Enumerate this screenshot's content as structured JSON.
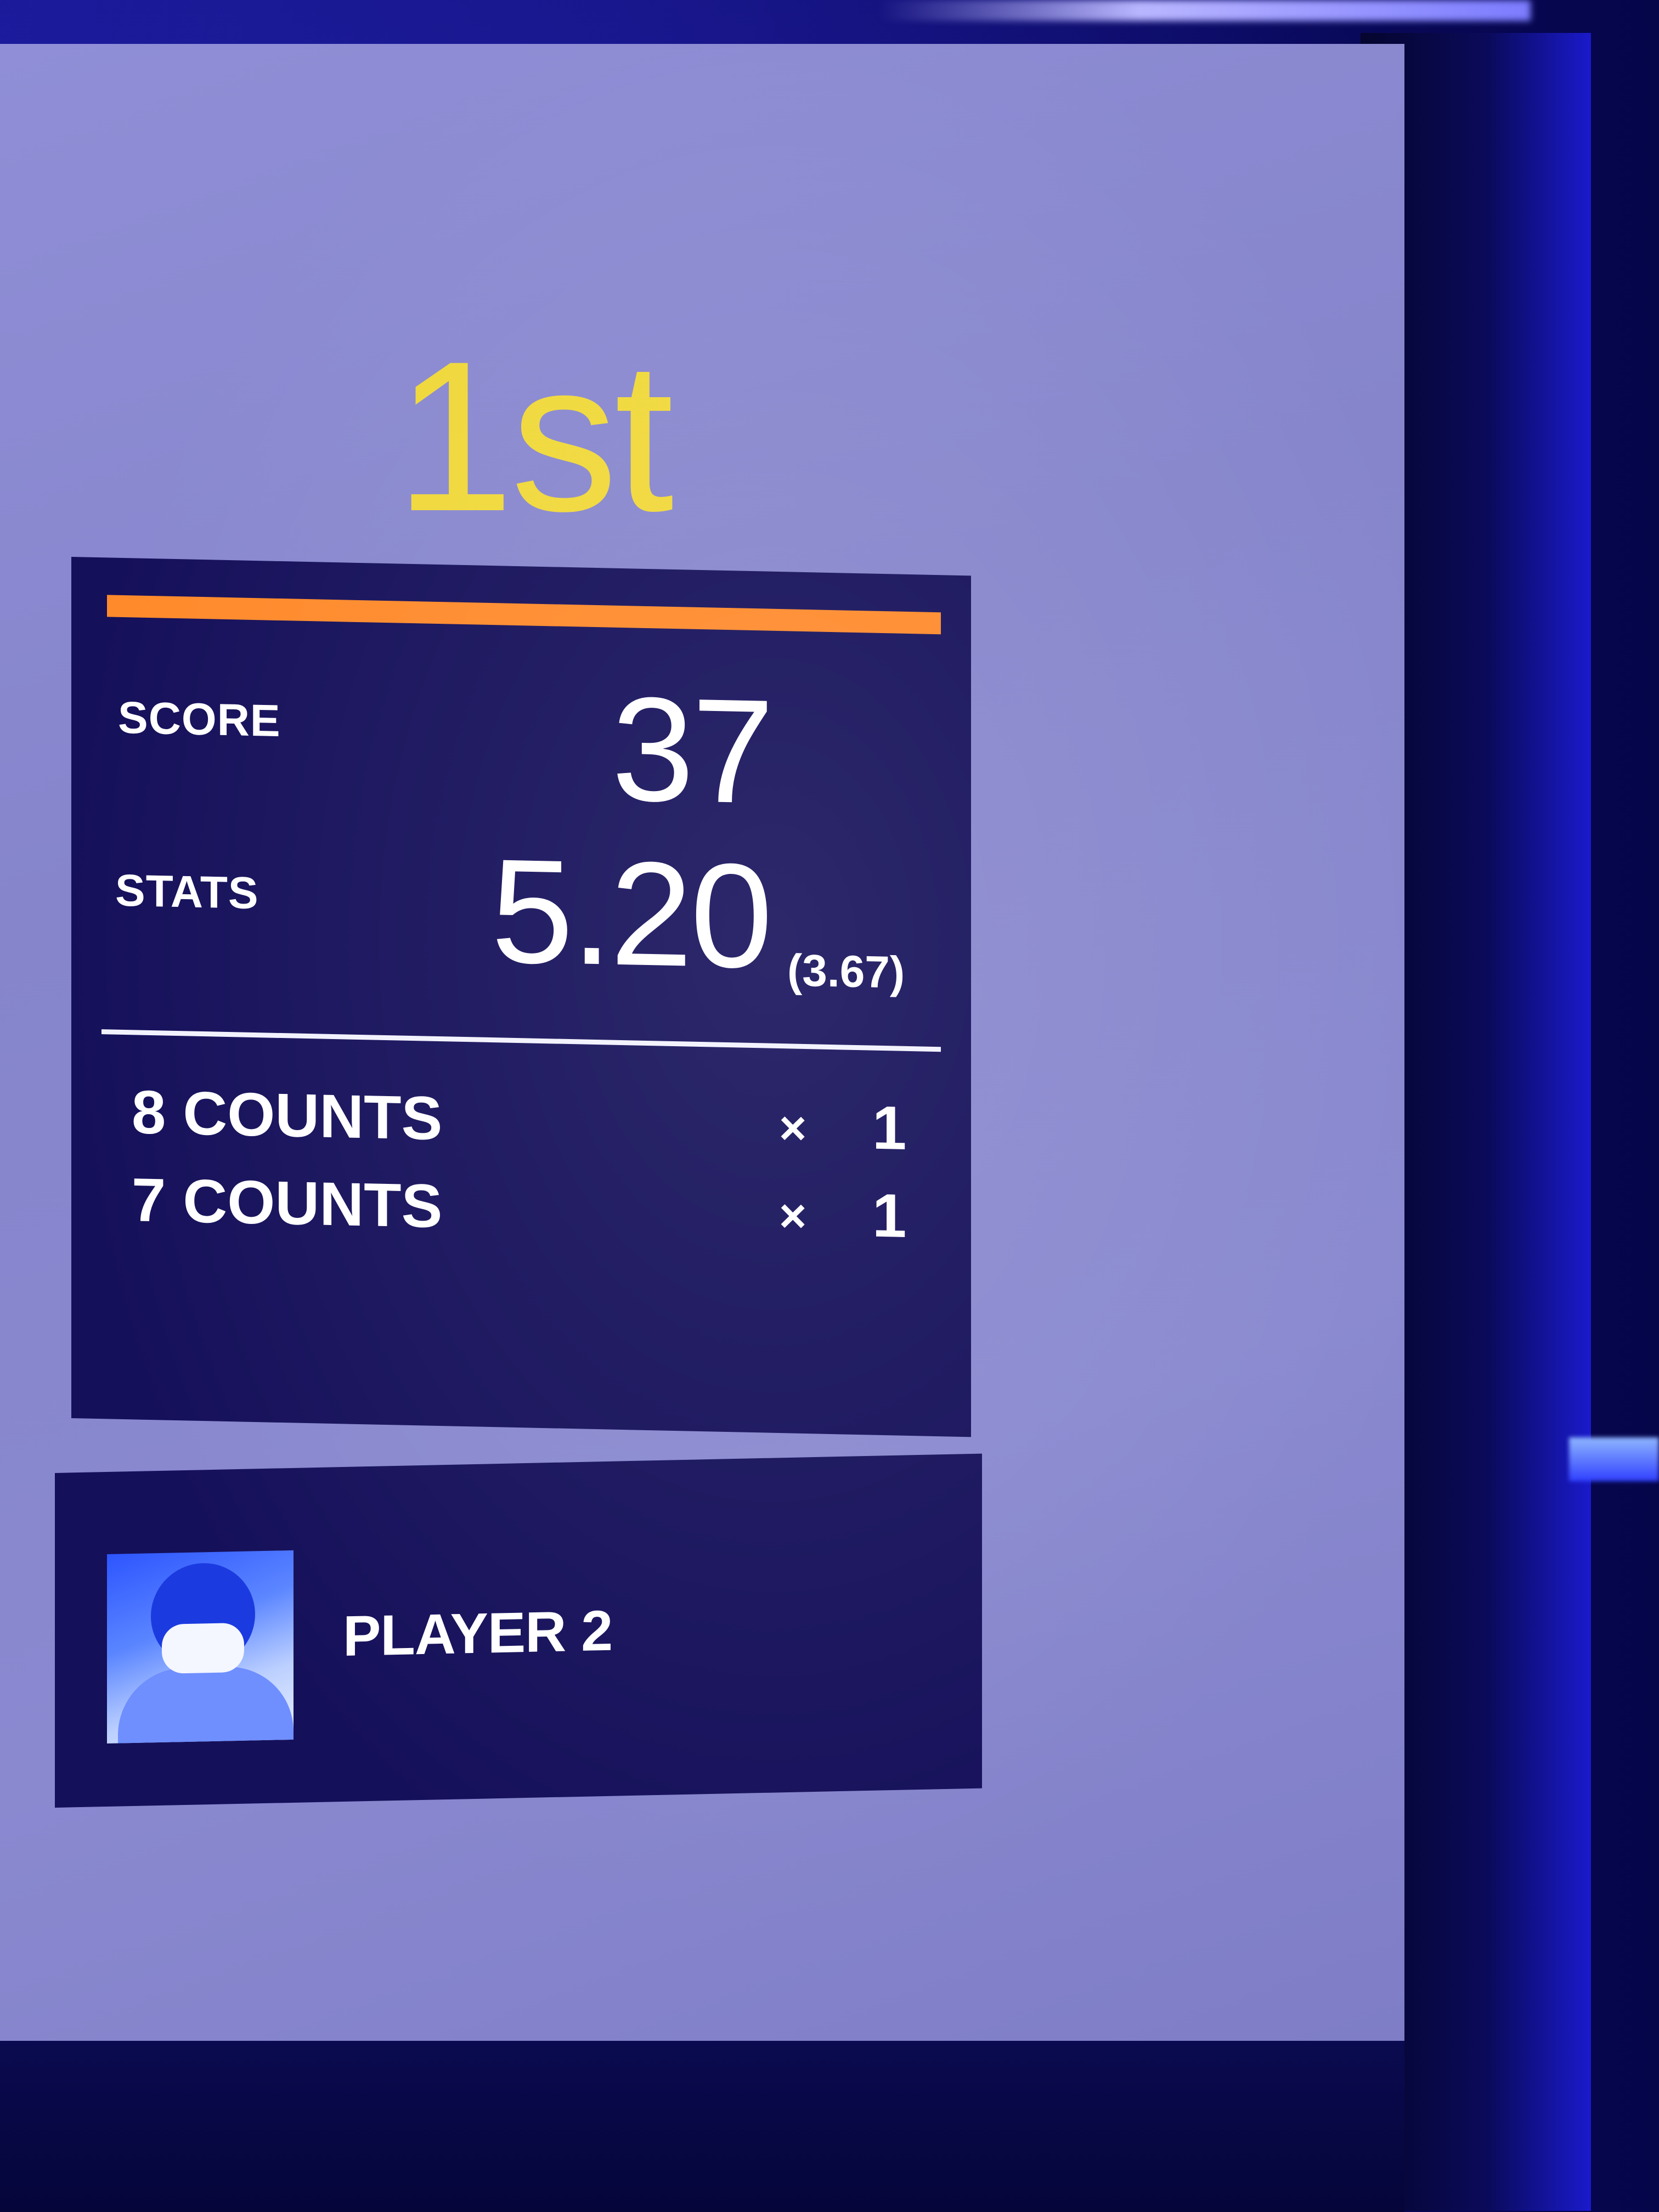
{
  "result": {
    "rank": "1st"
  },
  "score_card": {
    "score_label": "SCORE",
    "score_value": "37",
    "stats_label": "STATS",
    "stats_value": "5.20",
    "stats_sub": "(3.67)",
    "accent_color": "#ff8a2b",
    "counts": [
      {
        "label": "8 COUNTS",
        "multiplier": "×",
        "value": "1"
      },
      {
        "label": "7 COUNTS",
        "multiplier": "×",
        "value": "1"
      }
    ]
  },
  "player": {
    "name": "PLAYER 2",
    "avatar_icon": "player-photo-icon"
  },
  "colors": {
    "rank_color": "#f0d83a",
    "panel_bg": "#15105a",
    "screen_bg": "#8a89d0"
  }
}
